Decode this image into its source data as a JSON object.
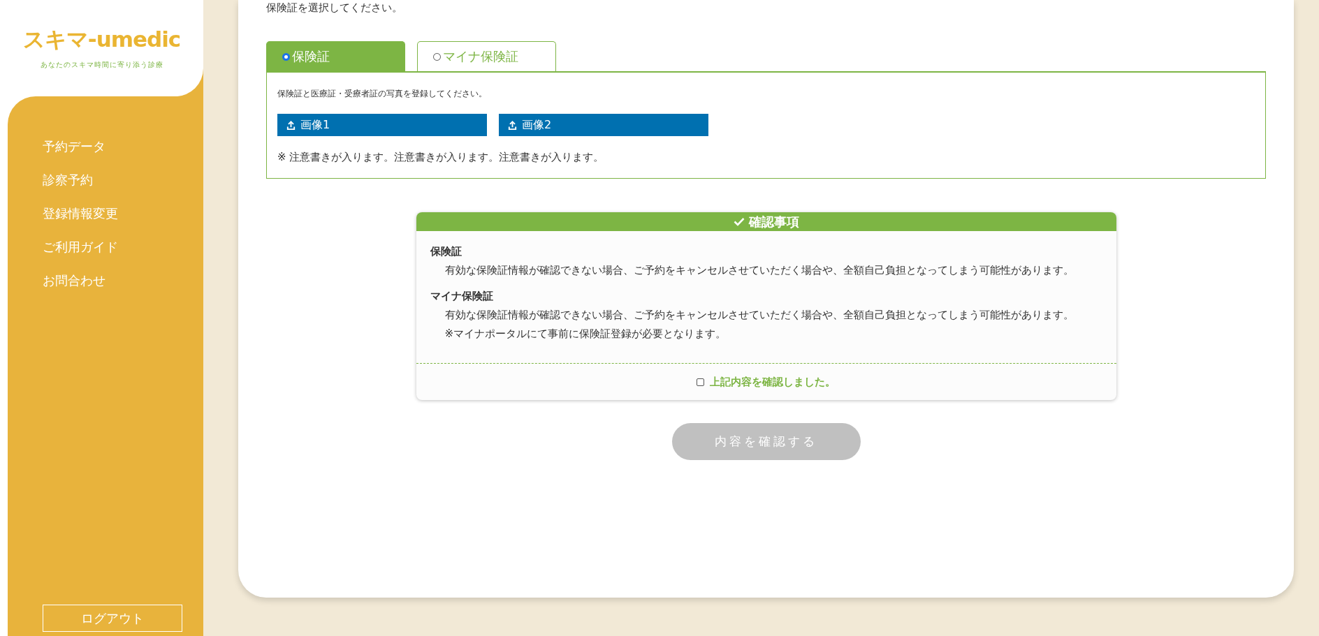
{
  "sidebar": {
    "logo": "スキマ-umedic",
    "tagline": "あなたのスキマ時間に寄り添う診療",
    "items": [
      {
        "label": "予約データ"
      },
      {
        "label": "診察予約"
      },
      {
        "label": "登録情報変更"
      },
      {
        "label": "ご利用ガイド"
      },
      {
        "label": "お問合わせ"
      }
    ],
    "logout": "ログアウト"
  },
  "instruction": "保険証を選択してください。",
  "tabs": [
    {
      "label": "保険証",
      "selected": true
    },
    {
      "label": "マイナ保険証",
      "selected": false
    }
  ],
  "panel": {
    "text": "保険証と医療証・受療者証の写真を登録してください。",
    "uploads": [
      "画像1",
      "画像2"
    ],
    "note": "※ 注意書きが入ります。注意書きが入ります。注意書きが入ります。"
  },
  "confirm": {
    "title": "確認事項",
    "sections": [
      {
        "heading": "保険証",
        "lines": [
          "有効な保険証情報が確認できない場合、ご予約をキャンセルさせていただく場合や、全額自己負担となってしまう可能性があります。"
        ]
      },
      {
        "heading": "マイナ保険証",
        "lines": [
          "有効な保険証情報が確認できない場合、ご予約をキャンセルさせていただく場合や、全額自己負担となってしまう可能性があります。",
          "※マイナポータルにて事前に保険証登録が必要となります。"
        ]
      }
    ],
    "checkbox": {
      "label": "上記内容を確認しました。",
      "checked": false
    }
  },
  "submit": {
    "label": "内容を確認する",
    "disabled": true
  }
}
